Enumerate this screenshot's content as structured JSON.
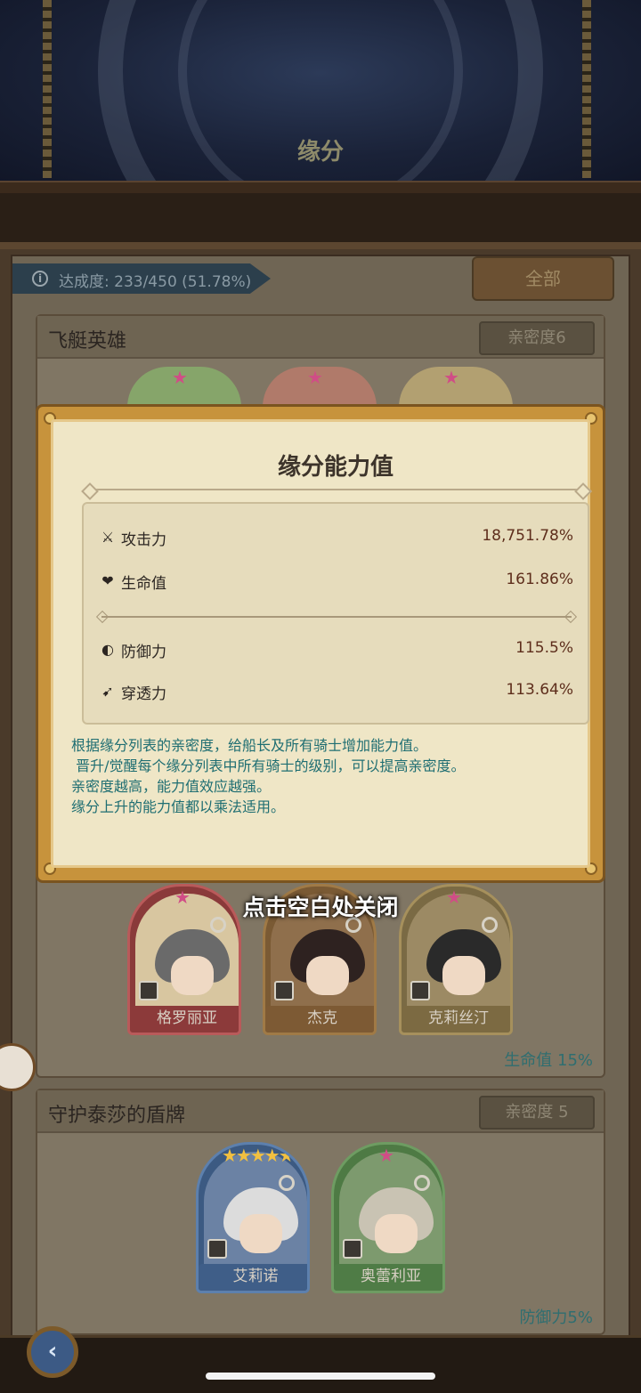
{
  "header": {
    "title": "缘分"
  },
  "progress": {
    "text": "达成度: 233/450 (51.78%)",
    "icon": "info-icon"
  },
  "filter": {
    "all_label": "全部"
  },
  "groups": [
    {
      "title": "飞艇英雄",
      "affinity": "亲密度6",
      "bonus": "生命值 15%",
      "heroes": [
        {
          "name": "格罗丽亚",
          "role_icon": "plus-icon"
        },
        {
          "name": "杰克",
          "role_icon": "shield-icon"
        },
        {
          "name": "克莉丝汀",
          "role_icon": "sword-icon"
        }
      ]
    },
    {
      "title": "守护泰莎的盾牌",
      "affinity": "亲密度 5",
      "bonus": "防御力5%",
      "heroes": [
        {
          "name": "艾莉诺",
          "role_icon": "shield-icon"
        },
        {
          "name": "奥蕾利亚",
          "role_icon": "shield-icon"
        }
      ]
    }
  ],
  "modal": {
    "title": "缘分能力值",
    "stats_primary": [
      {
        "label": "攻击力",
        "value": "18,751.78%",
        "icon": "sword-icon"
      },
      {
        "label": "生命值",
        "value": "161.86%",
        "icon": "heart-plus-icon"
      }
    ],
    "stats_secondary": [
      {
        "label": "防御力",
        "value": "115.5%",
        "icon": "half-shield-icon"
      },
      {
        "label": "穿透力",
        "value": "113.64%",
        "icon": "pierce-icon"
      }
    ],
    "description": [
      "根据缘分列表的亲密度，给船长及所有骑士增加能力值。",
      " 晋升/觉醒每个缘分列表中所有骑士的级别，可以提高亲密度。",
      "亲密度越高，能力值效应越强。",
      "缘分上升的能力值都以乘法适用。"
    ]
  },
  "close_hint": "点击空白处关闭",
  "nav": {
    "back_icon": "back-arrow-icon"
  }
}
